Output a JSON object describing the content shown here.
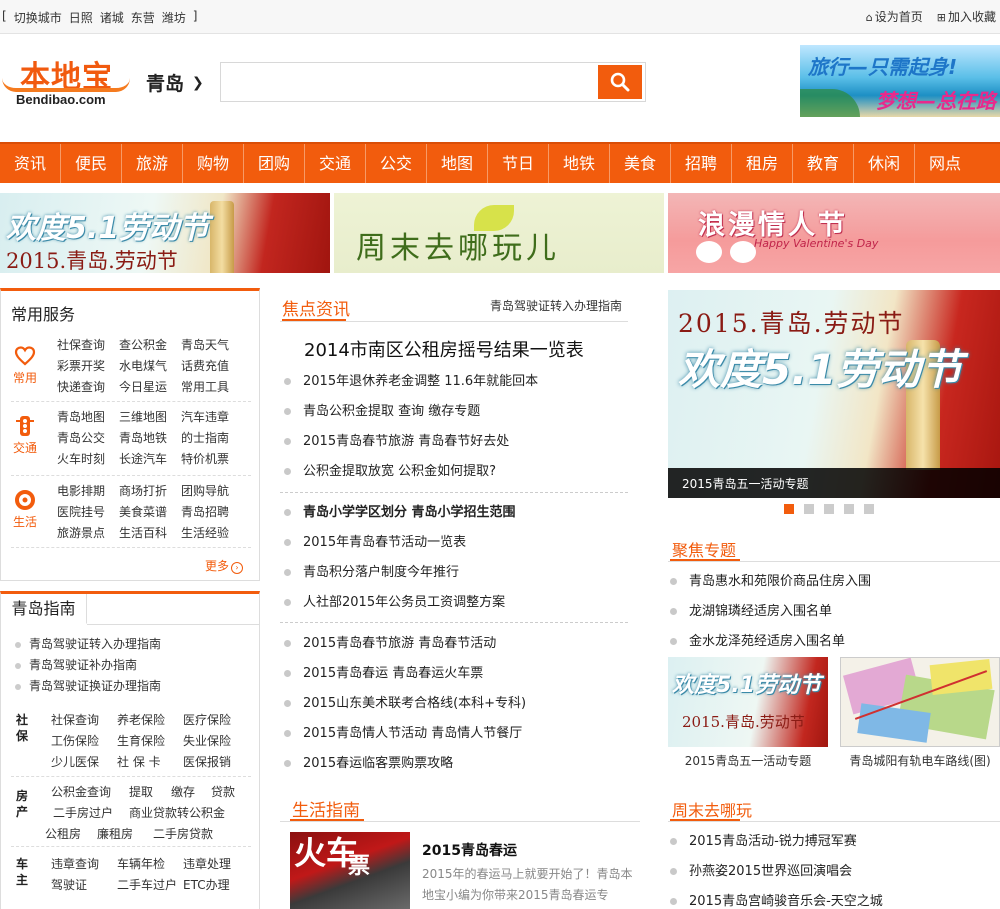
{
  "topbar": {
    "bracket_open": "[",
    "switch_label": "切换城市",
    "cities": [
      "日照",
      "诸城",
      "东营",
      "潍坊"
    ],
    "bracket_close": "]",
    "home_label": "设为首页",
    "fav_label": "加入收藏"
  },
  "header": {
    "logo_cn": "本地宝",
    "logo_en": "Bendibao.com",
    "city": "青岛",
    "search_placeholder": "",
    "ad_line1": "旅行—只需起身!",
    "ad_line2": "梦想—总在路上"
  },
  "nav": [
    "资讯",
    "便民",
    "旅游",
    "购物",
    "团购",
    "交通",
    "公交",
    "地图",
    "节日",
    "地铁",
    "美食",
    "招聘",
    "租房",
    "教育",
    "休闲",
    "网点"
  ],
  "banners": {
    "b1_big": "欢度5.1劳动节",
    "b1_sub": "2015.青岛.劳动节",
    "b2": "周末去哪玩儿",
    "b3_big": "浪漫情人节",
    "b3_sub": "Happy Valentine's Day"
  },
  "services": {
    "title": "常用服务",
    "groups": [
      {
        "label": "常用",
        "icon": "heart-icon",
        "links": [
          "社保查询",
          "查公积金",
          "青岛天气",
          "彩票开奖",
          "水电煤气",
          "话费充值",
          "快递查询",
          "今日星运",
          "常用工具"
        ]
      },
      {
        "label": "交通",
        "icon": "traffic-light-icon",
        "links": [
          "青岛地图",
          "三维地图",
          "汽车违章",
          "青岛公交",
          "青岛地铁",
          "的士指南",
          "火车时刻",
          "长途汽车",
          "特价机票"
        ]
      },
      {
        "label": "生活",
        "icon": "life-circle-icon",
        "links": [
          "电影排期",
          "商场打折",
          "团购导航",
          "医院挂号",
          "美食菜谱",
          "青岛招聘",
          "旅游景点",
          "生活百科",
          "生活经验"
        ]
      }
    ],
    "more": "更多",
    "more_arrow": "›"
  },
  "guide": {
    "title": "青岛指南",
    "items": [
      "青岛驾驶证转入办理指南",
      "青岛驾驶证补办指南",
      "青岛驾驶证换证办理指南"
    ],
    "cats": [
      {
        "label": "社保",
        "links": [
          "社保查询",
          "养老保险",
          "医疗保险",
          "工伤保险",
          "生育保险",
          "失业保险",
          "少儿医保",
          "社 保 卡",
          "医保报销"
        ]
      },
      {
        "label": "房产",
        "links": [
          "公积金查询",
          "提取",
          "缴存",
          "贷款",
          "二手房过户",
          "商业贷款转公积金",
          "公租房",
          "廉租房",
          "二手房贷款"
        ]
      },
      {
        "label": "车主",
        "links": [
          "违章查询",
          "车辆年检",
          "违章处理",
          "驾驶证",
          "二手车过户",
          "ETC办理"
        ]
      }
    ]
  },
  "focus": {
    "title": "焦点资讯",
    "right_link": "青岛驾驶证转入办理指南",
    "headline": "2014市南区公租房摇号结果一览表",
    "list1": [
      "2015年退休养老金调整 11.6年就能回本",
      "青岛公积金提取 查询 缴存专题",
      "2015青岛春节旅游 青岛春节好去处",
      "公积金提取放宽 公积金如何提取?"
    ],
    "list2_bold": "青岛小学学区划分 青岛小学招生范围",
    "list2": [
      "2015年青岛春节活动一览表",
      "青岛积分落户制度今年推行",
      "人社部2015年公务员工资调整方案"
    ],
    "list3": [
      "2015青岛春节旅游 青岛春节活动",
      "2015青岛春运 青岛春运火车票",
      "2015山东美术联考合格线(本科+专科)",
      "2015青岛情人节活动 青岛情人节餐厅",
      "2015春运临客票购票攻略"
    ]
  },
  "life": {
    "title": "生活指南",
    "pic_big": "火车",
    "pic_small": "票",
    "article_title": "2015青岛春运",
    "article_desc": "2015年的春运马上就要开始了！青岛本地宝小编为你带来2015青岛春运专"
  },
  "slider": {
    "line1": "2015.青岛.劳动节",
    "line2": "欢度5.1劳动节",
    "caption": "2015青岛五一活动专题",
    "count": 5,
    "active": 0
  },
  "topics": {
    "title": "聚焦专题",
    "items": [
      "青岛惠水和苑限价商品住房入围",
      "龙湖锦璘经适房入围名单",
      "金水龙泽苑经适房入围名单"
    ],
    "thumb1_big": "欢度5.1劳动节",
    "thumb1_small": "2015.青岛.劳动节",
    "thumb1_caption": "2015青岛五一活动专题",
    "thumb2_caption": "青岛城阳有轨电车路线(图)"
  },
  "weekend": {
    "title": "周末去哪玩",
    "items": [
      "2015青岛活动-锐力搏冠军赛",
      "孙燕姿2015世界巡回演唱会",
      "2015青岛宫崎骏音乐会-天空之城"
    ]
  },
  "colors": {
    "brand": "#f25c0d",
    "nav_bg": "#f25c0d"
  }
}
